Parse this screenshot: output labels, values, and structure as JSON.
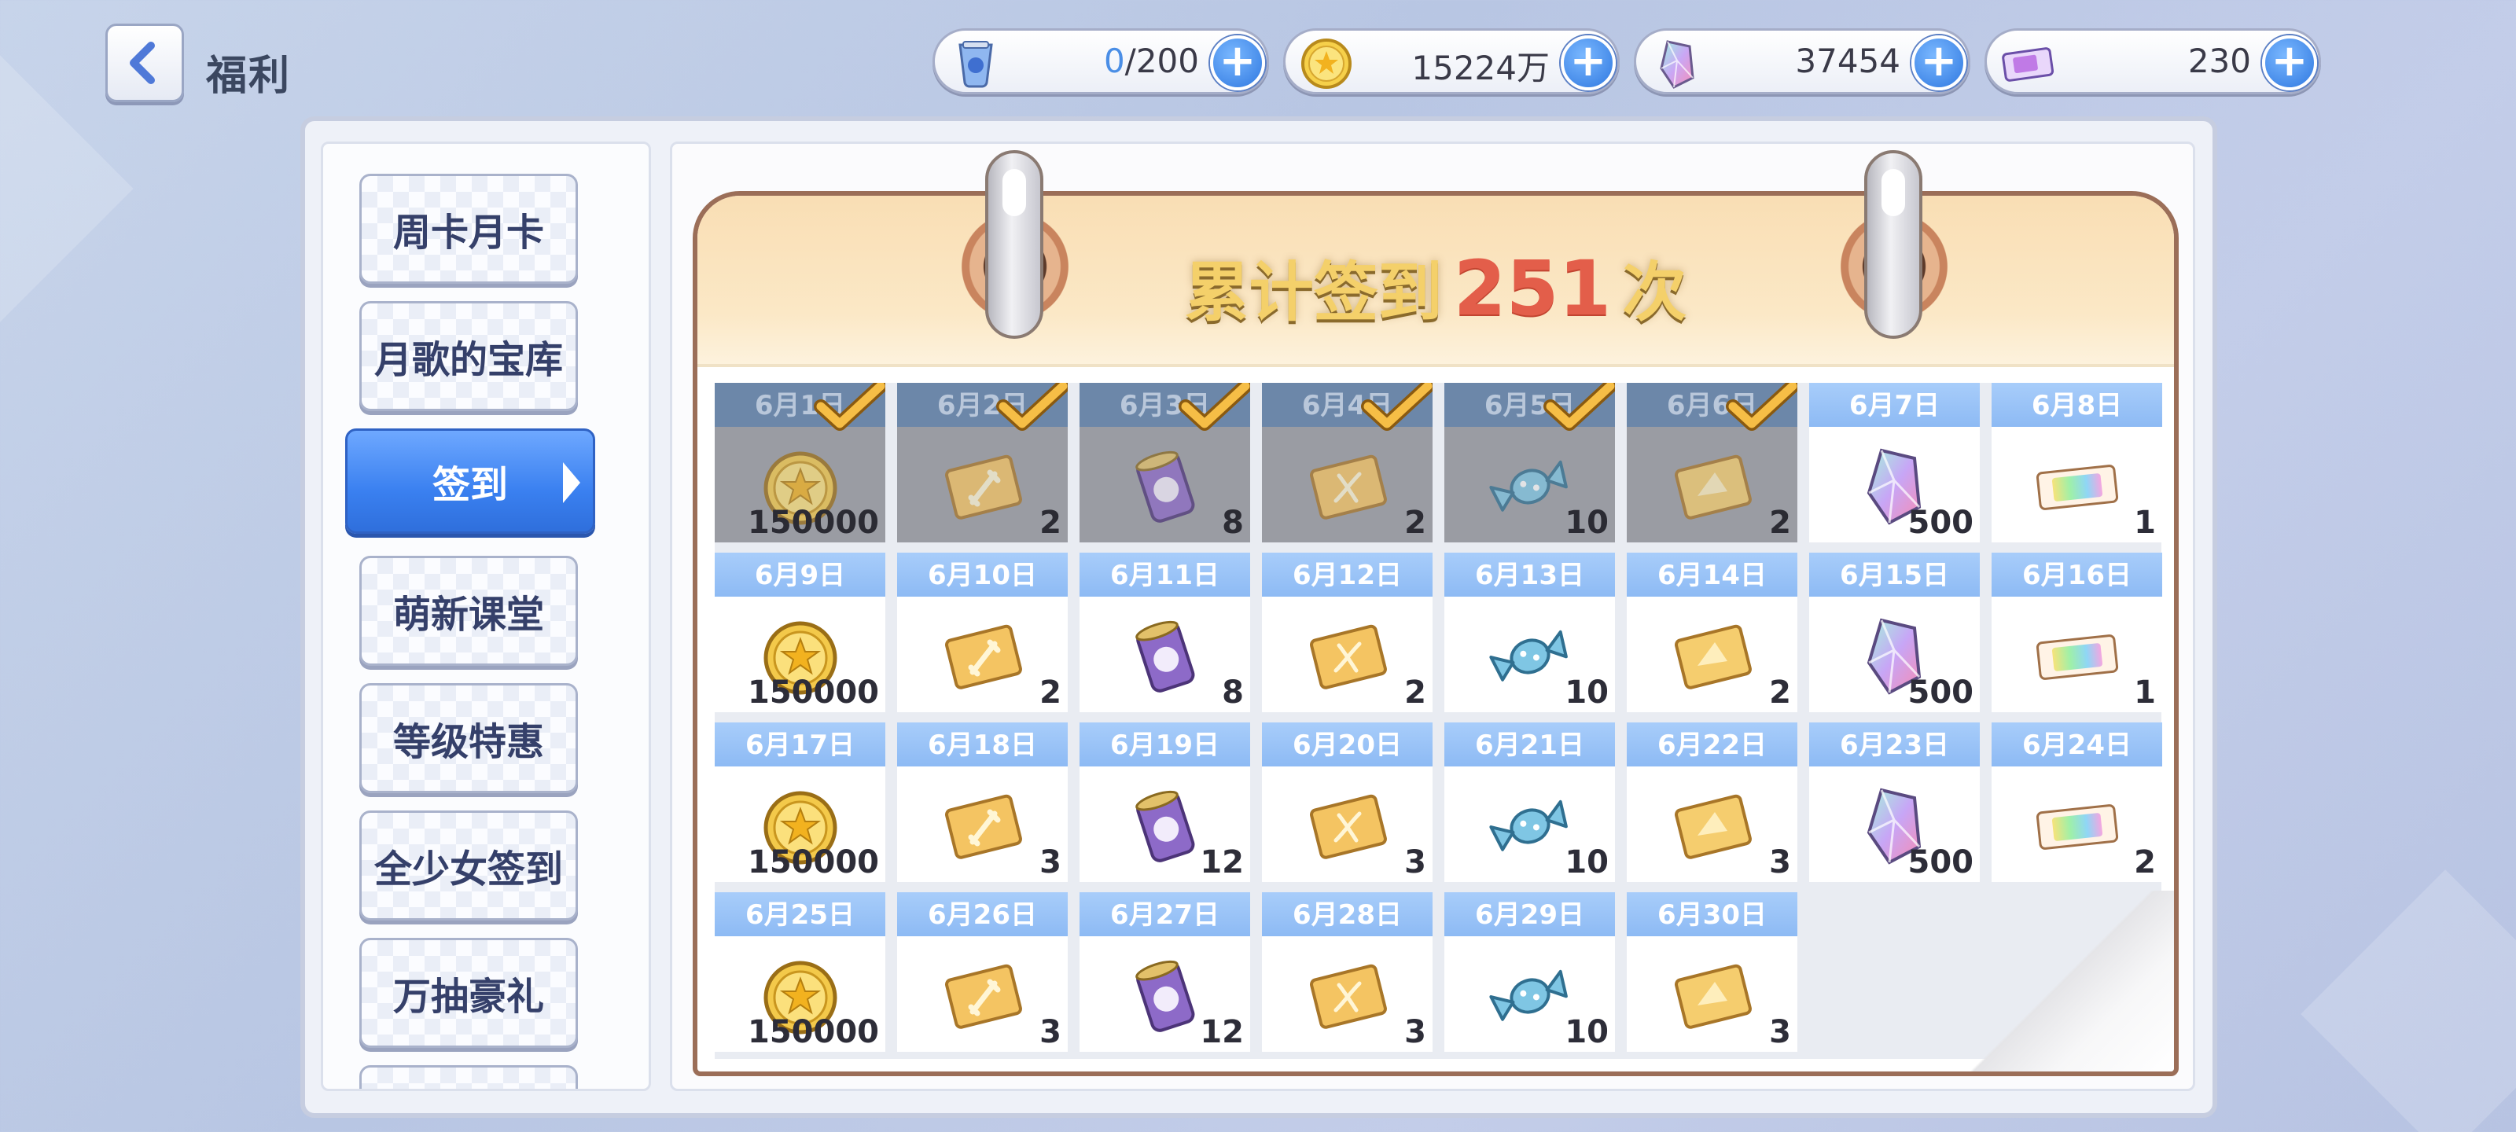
{
  "header": {
    "back_label": "<",
    "title": "福利"
  },
  "resources": [
    {
      "name": "stamina",
      "icon": "stamina-potion-icon",
      "current": "0",
      "suffix": "/200"
    },
    {
      "name": "coins",
      "icon": "gold-coin-icon",
      "value": "15224万"
    },
    {
      "name": "jewels",
      "icon": "jewel-icon",
      "value": "37454"
    },
    {
      "name": "tickets",
      "icon": "gacha-ticket-icon",
      "value": "230"
    }
  ],
  "sidebar": {
    "items": [
      {
        "label": "周卡月卡"
      },
      {
        "label": "月歌的宝库"
      },
      {
        "label": "签到",
        "active": true
      },
      {
        "label": "萌新课堂"
      },
      {
        "label": "等级特惠"
      },
      {
        "label": "全少女签到"
      },
      {
        "label": "万抽豪礼"
      }
    ]
  },
  "calendar": {
    "title_prefix": "累计签到",
    "count": "251",
    "title_suffix": "次",
    "days": [
      {
        "date": "6月1日",
        "item": "coin",
        "qty": "150000",
        "done": true
      },
      {
        "date": "6月2日",
        "item": "sword-ticket",
        "qty": "2",
        "done": true
      },
      {
        "date": "6月3日",
        "item": "purple-can",
        "qty": "8",
        "done": true
      },
      {
        "date": "6月4日",
        "item": "dna-ticket",
        "qty": "2",
        "done": true
      },
      {
        "date": "6月5日",
        "item": "candy",
        "qty": "10",
        "done": true
      },
      {
        "date": "6月6日",
        "item": "gold-ticket",
        "qty": "2",
        "done": true
      },
      {
        "date": "6月7日",
        "item": "jewel",
        "qty": "500",
        "done": false
      },
      {
        "date": "6月8日",
        "item": "rainbow-ticket",
        "qty": "1",
        "done": false
      },
      {
        "date": "6月9日",
        "item": "coin",
        "qty": "150000",
        "done": false
      },
      {
        "date": "6月10日",
        "item": "sword-ticket",
        "qty": "2",
        "done": false
      },
      {
        "date": "6月11日",
        "item": "purple-can",
        "qty": "8",
        "done": false
      },
      {
        "date": "6月12日",
        "item": "dna-ticket",
        "qty": "2",
        "done": false
      },
      {
        "date": "6月13日",
        "item": "candy",
        "qty": "10",
        "done": false
      },
      {
        "date": "6月14日",
        "item": "gold-ticket",
        "qty": "2",
        "done": false
      },
      {
        "date": "6月15日",
        "item": "jewel",
        "qty": "500",
        "done": false
      },
      {
        "date": "6月16日",
        "item": "rainbow-ticket",
        "qty": "1",
        "done": false
      },
      {
        "date": "6月17日",
        "item": "coin",
        "qty": "150000",
        "done": false
      },
      {
        "date": "6月18日",
        "item": "sword-ticket",
        "qty": "3",
        "done": false
      },
      {
        "date": "6月19日",
        "item": "purple-can",
        "qty": "12",
        "done": false
      },
      {
        "date": "6月20日",
        "item": "dna-ticket",
        "qty": "3",
        "done": false
      },
      {
        "date": "6月21日",
        "item": "candy",
        "qty": "10",
        "done": false
      },
      {
        "date": "6月22日",
        "item": "gold-ticket",
        "qty": "3",
        "done": false
      },
      {
        "date": "6月23日",
        "item": "jewel",
        "qty": "500",
        "done": false
      },
      {
        "date": "6月24日",
        "item": "rainbow-ticket",
        "qty": "2",
        "done": false
      },
      {
        "date": "6月25日",
        "item": "coin",
        "qty": "150000",
        "done": false
      },
      {
        "date": "6月26日",
        "item": "sword-ticket",
        "qty": "3",
        "done": false
      },
      {
        "date": "6月27日",
        "item": "purple-can",
        "qty": "12",
        "done": false
      },
      {
        "date": "6月28日",
        "item": "dna-ticket",
        "qty": "3",
        "done": false
      },
      {
        "date": "6月29日",
        "item": "candy",
        "qty": "10",
        "done": false
      },
      {
        "date": "6月30日",
        "item": "gold-ticket",
        "qty": "3",
        "done": false
      }
    ]
  },
  "colors": {
    "accent_blue": "#3a80f0",
    "date_header": "#8dbaf4",
    "count_red": "#e35e4a",
    "check_gold": "#f2b23a"
  }
}
